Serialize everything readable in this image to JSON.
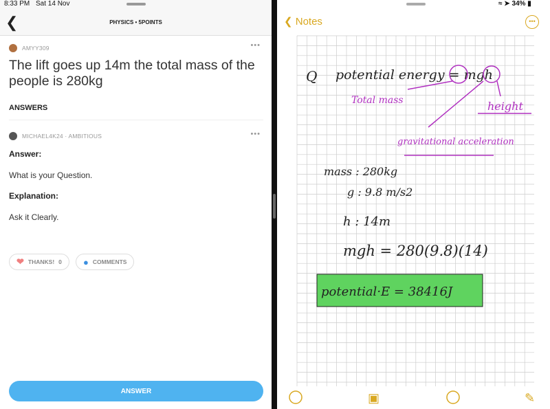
{
  "status": {
    "time": "8:33 PM",
    "date": "Sat 14 Nov",
    "battery": "34%"
  },
  "question": {
    "subject": "PHYSICS • 5POINTS",
    "author": "AMYY309",
    "text": "The lift goes up 14m the total mass of the people is 280kg"
  },
  "answers": {
    "heading": "ANSWERS",
    "author": "MICHAEL4K24 · AMBITIOUS",
    "answer_label": "Answer:",
    "answer_text": "What is your Question.",
    "explanation_label": "Explanation:",
    "explanation_text": "Ask it Clearly.",
    "thanks_label": "THANKS!",
    "thanks_count": "0",
    "comments_label": "COMMENTS"
  },
  "answer_button": "ANSWER",
  "notes": {
    "back_label": "Notes",
    "lines": {
      "q": "Q",
      "formula": "potential energy = mgh",
      "total_mass": "Total mass",
      "height": "height",
      "gravity": "gravitational acceleration",
      "mass": "mass : 280kg",
      "g": "g : 9.8 m/s2",
      "h": "h : 14m",
      "calc": "mgh = 280(9.8)(14)",
      "result": "potential·E =   38416J"
    },
    "colors": {
      "accent": "#d9a820",
      "annotation": "#b030c0",
      "highlight": "#5fd35f"
    }
  }
}
